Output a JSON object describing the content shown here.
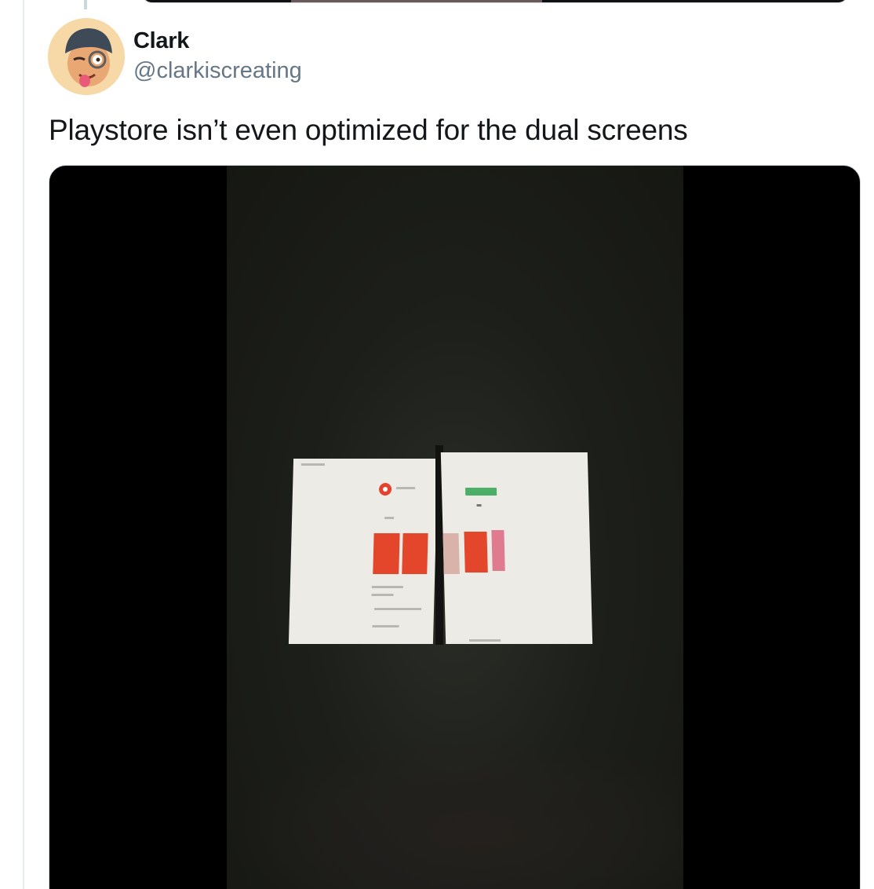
{
  "tweet": {
    "author_name": "Clark",
    "author_handle": "@clarkiscreating",
    "text": "Playstore isn’t even optimized for the dual screens"
  },
  "avatar": {
    "icon": "memoji-avatar-icon",
    "background_color": "#f6d9a6"
  },
  "media": {
    "type": "video",
    "icon": "video-thumbnail"
  },
  "colors": {
    "name_text": "#14171a",
    "handle_text": "#657786",
    "border": "#ccd6dd",
    "thread_line": "#e6ecf0"
  }
}
